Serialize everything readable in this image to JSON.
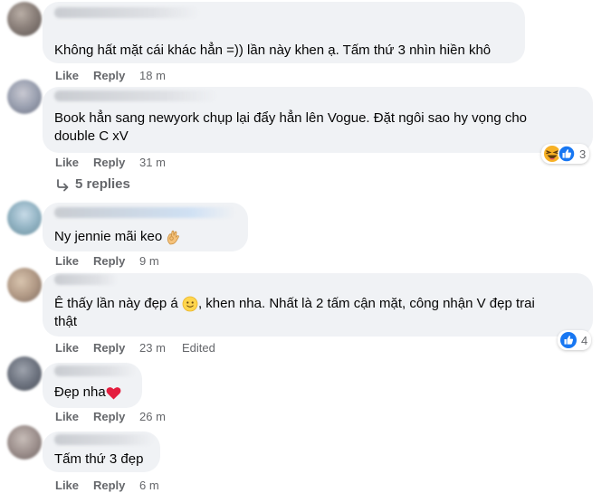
{
  "actions": {
    "like": "Like",
    "reply": "Reply"
  },
  "comments": [
    {
      "text": "Không hất mặt cái khác hẳn =)) lần này khen ạ. Tấm thứ 3 nhìn hiền khô",
      "time": "18 m"
    },
    {
      "text_line1": "Book hẳn sang newyork chụp lại đẩy hẳn lên Vogue. Đặt ngôi sao hy vọng cho",
      "text_line2": "double C xV",
      "time": "31 m",
      "reactions": {
        "types": [
          "haha-icon",
          "like-icon"
        ],
        "count": "3"
      },
      "replies": "5 replies"
    },
    {
      "text": "Ny jennie mãi keo",
      "time": "9 m",
      "emoji": "ok-hand-icon"
    },
    {
      "text_line1": "Ê thấy lần này đẹp á",
      "text_line1b": ", khen nha. Nhất là 2 tấm cận mặt, công nhận V đẹp trai",
      "text_line2": "thật",
      "time": "23 m",
      "edited": "Edited",
      "reactions": {
        "types": [
          "like-icon"
        ],
        "count": "4"
      }
    },
    {
      "text": "Đẹp nha",
      "time": "26 m",
      "emoji": "red-heart-icon"
    },
    {
      "text": "Tấm thứ 3 đẹp",
      "time": "6 m"
    }
  ],
  "colors": {
    "bubble": "#f0f2f5",
    "meta": "#65676b",
    "like_blue": "#1877f2",
    "heart_red": "#e41e3f"
  }
}
